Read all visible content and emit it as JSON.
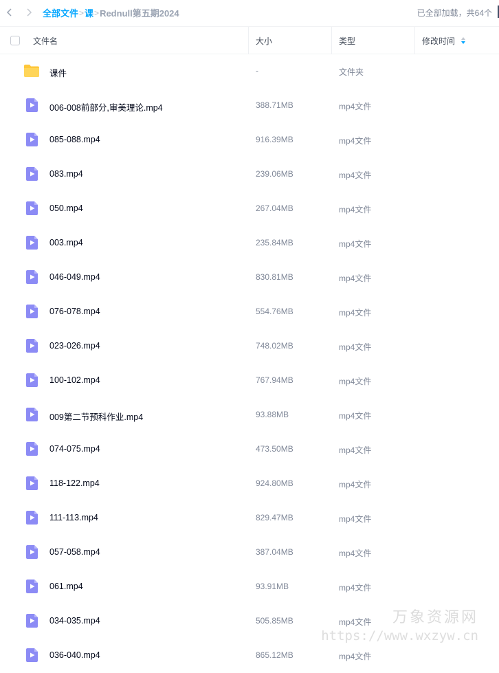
{
  "breadcrumb": {
    "root": "全部文件",
    "level1": "课",
    "current": "Rednull第五期2024",
    "separator": ">"
  },
  "status_text": "已全部加载，共64个",
  "columns": {
    "name": "文件名",
    "size": "大小",
    "type": "类型",
    "modified": "修改时间"
  },
  "files": [
    {
      "name": "课件",
      "size": "-",
      "type": "文件夹",
      "icon": "folder-icon"
    },
    {
      "name": "006-008前部分,审美理论.mp4",
      "size": "388.71MB",
      "type": "mp4文件",
      "icon": "video-file-icon"
    },
    {
      "name": "085-088.mp4",
      "size": "916.39MB",
      "type": "mp4文件",
      "icon": "video-file-icon"
    },
    {
      "name": "083.mp4",
      "size": "239.06MB",
      "type": "mp4文件",
      "icon": "video-file-icon"
    },
    {
      "name": "050.mp4",
      "size": "267.04MB",
      "type": "mp4文件",
      "icon": "video-file-icon"
    },
    {
      "name": "003.mp4",
      "size": "235.84MB",
      "type": "mp4文件",
      "icon": "video-file-icon"
    },
    {
      "name": "046-049.mp4",
      "size": "830.81MB",
      "type": "mp4文件",
      "icon": "video-file-icon"
    },
    {
      "name": "076-078.mp4",
      "size": "554.76MB",
      "type": "mp4文件",
      "icon": "video-file-icon"
    },
    {
      "name": "023-026.mp4",
      "size": "748.02MB",
      "type": "mp4文件",
      "icon": "video-file-icon"
    },
    {
      "name": "100-102.mp4",
      "size": "767.94MB",
      "type": "mp4文件",
      "icon": "video-file-icon"
    },
    {
      "name": "009第二节预科作业.mp4",
      "size": "93.88MB",
      "type": "mp4文件",
      "icon": "video-file-icon"
    },
    {
      "name": "074-075.mp4",
      "size": "473.50MB",
      "type": "mp4文件",
      "icon": "video-file-icon"
    },
    {
      "name": "118-122.mp4",
      "size": "924.80MB",
      "type": "mp4文件",
      "icon": "video-file-icon"
    },
    {
      "name": "111-113.mp4",
      "size": "829.47MB",
      "type": "mp4文件",
      "icon": "video-file-icon"
    },
    {
      "name": "057-058.mp4",
      "size": "387.04MB",
      "type": "mp4文件",
      "icon": "video-file-icon"
    },
    {
      "name": "061.mp4",
      "size": "93.91MB",
      "type": "mp4文件",
      "icon": "video-file-icon"
    },
    {
      "name": "034-035.mp4",
      "size": "505.85MB",
      "type": "mp4文件",
      "icon": "video-file-icon"
    },
    {
      "name": "036-040.mp4",
      "size": "865.12MB",
      "type": "mp4文件",
      "icon": "video-file-icon"
    }
  ],
  "watermark": {
    "title": "万象资源网",
    "url": "https://www.wxzyw.cn"
  },
  "colors": {
    "accent": "#06a7ff",
    "folder": "#ffc73a",
    "video": "#8c8bf5"
  }
}
